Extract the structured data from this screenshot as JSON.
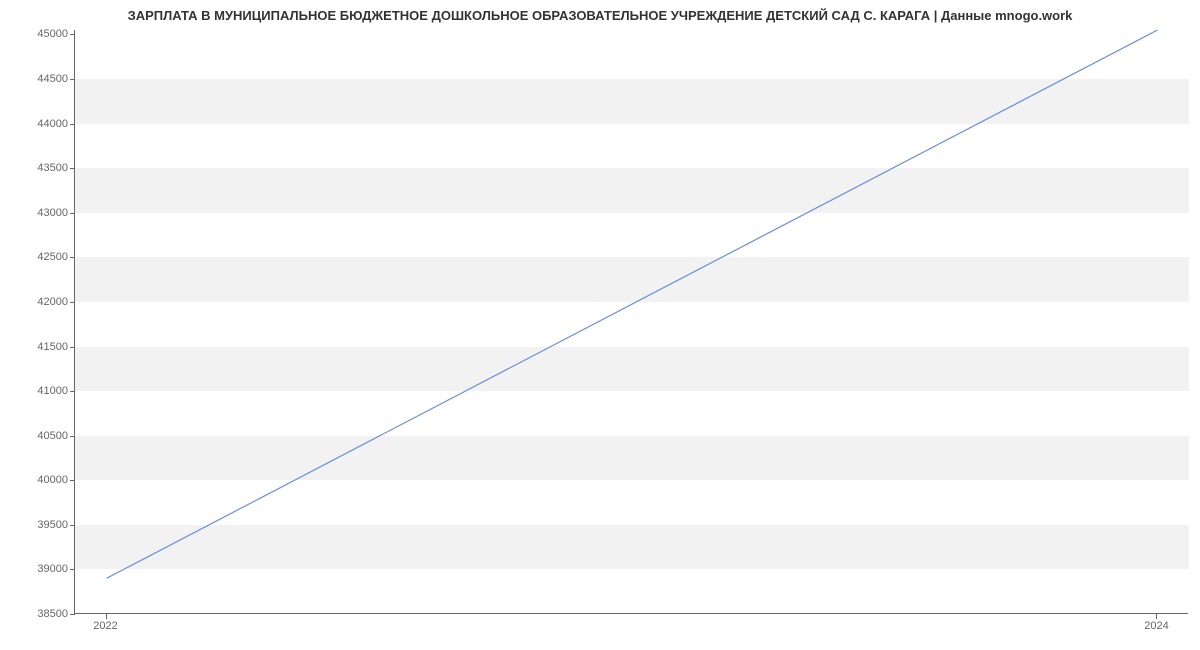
{
  "chart_data": {
    "type": "line",
    "title": "ЗАРПЛАТА В МУНИЦИПАЛЬНОЕ БЮДЖЕТНОЕ ДОШКОЛЬНОЕ ОБРАЗОВАТЕЛЬНОЕ УЧРЕЖДЕНИЕ ДЕТСКИЙ САД С. КАРАГА | Данные mnogo.work",
    "xlabel": "",
    "ylabel": "",
    "x": [
      2022,
      2024
    ],
    "values": [
      38900,
      45050
    ],
    "x_ticks": [
      2022,
      2024
    ],
    "y_ticks": [
      38500,
      39000,
      39500,
      40000,
      40500,
      41000,
      41500,
      42000,
      42500,
      43000,
      43500,
      44000,
      44500,
      45000
    ],
    "xlim": [
      2021.94,
      2024.06
    ],
    "ylim": [
      38500,
      45050
    ],
    "grid": true,
    "line_color": "#6a8fd8"
  }
}
